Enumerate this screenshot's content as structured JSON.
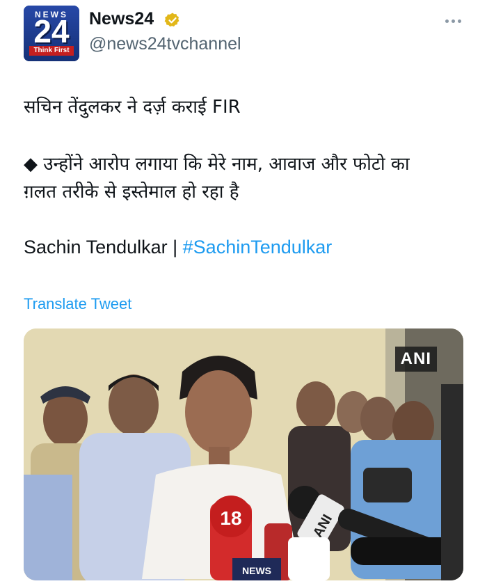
{
  "account": {
    "display_name": "News24",
    "handle": "@news24tvchannel",
    "verified_icon": "verified-badge-icon",
    "avatar": {
      "top_text": "NEWS",
      "number": "24",
      "tagline": "Think First"
    }
  },
  "tweet": {
    "line1": "सचिन तेंदुलकर ने दर्ज़ कराई FIR",
    "line2": "◆ उन्होंने आरोप लगाया कि मेरे नाम, आवाज और फोटो का",
    "line3": "ग़लत तरीके से इस्तेमाल हो रहा है",
    "line4_text": "Sachin Tendulkar | ",
    "hashtag": "#SachinTendulkar",
    "translate_label": "Translate Tweet"
  },
  "media": {
    "watermark": "ANI",
    "mic_labels": [
      "18",
      "ANI",
      "NEWS"
    ]
  },
  "colors": {
    "link": "#1d9bf0",
    "verified_gold": "#e2b719",
    "secondary_text": "#536471"
  }
}
